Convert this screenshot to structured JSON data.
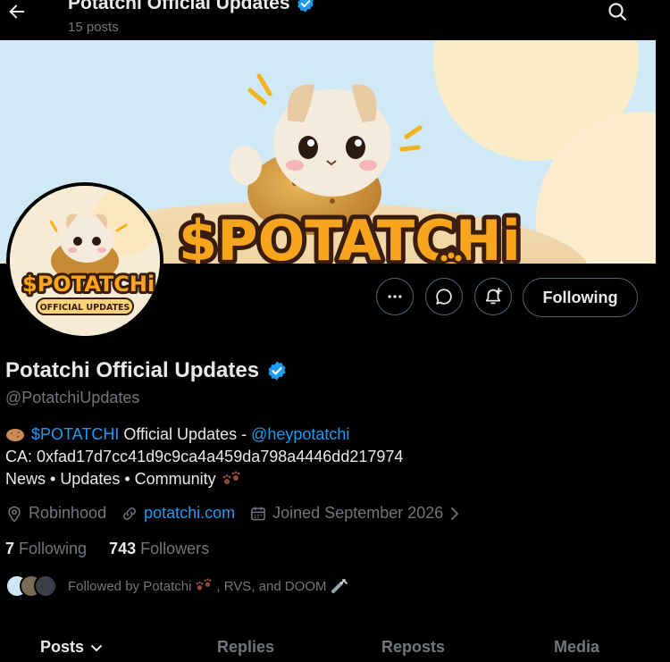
{
  "header": {
    "title": "Potatchi Official Updates",
    "posts_count": "15 posts"
  },
  "banner": {
    "logo_text": "$POTATCHi"
  },
  "avatar": {
    "logo_text": "$POTATCHi",
    "subtitle": "OFFICIAL UPDATES"
  },
  "actions": {
    "follow_label": "Following"
  },
  "profile": {
    "name": "Potatchi Official Updates",
    "handle": "@PotatchiUpdates",
    "bio": {
      "line1_ticker": "$POTATCHI",
      "line1_text": " Official Updates - ",
      "line1_mention": "@heypotatchi",
      "line2": "CA: 0xfad17d7cc41d9c9ca4a459da798a4446dd217974",
      "line3": "News • Updates • Community"
    },
    "location": "Robinhood",
    "website": "potatchi.com",
    "joined": "Joined September 2026",
    "following_count": "7",
    "following_label": "Following",
    "followers_count": "743",
    "followers_label": "Followers",
    "followed_by": "Followed by Potatchi",
    "followed_by_rest": ", RVS, and DOOM"
  },
  "tabs": [
    "Posts",
    "Replies",
    "Reposts",
    "Media"
  ],
  "colors": {
    "accent": "#1d9bf0",
    "muted": "#71767b",
    "text": "#e7e9ea",
    "border": "#536471",
    "banner_bg": "#cfe9f6",
    "logo_orange": "#f7a51c"
  }
}
